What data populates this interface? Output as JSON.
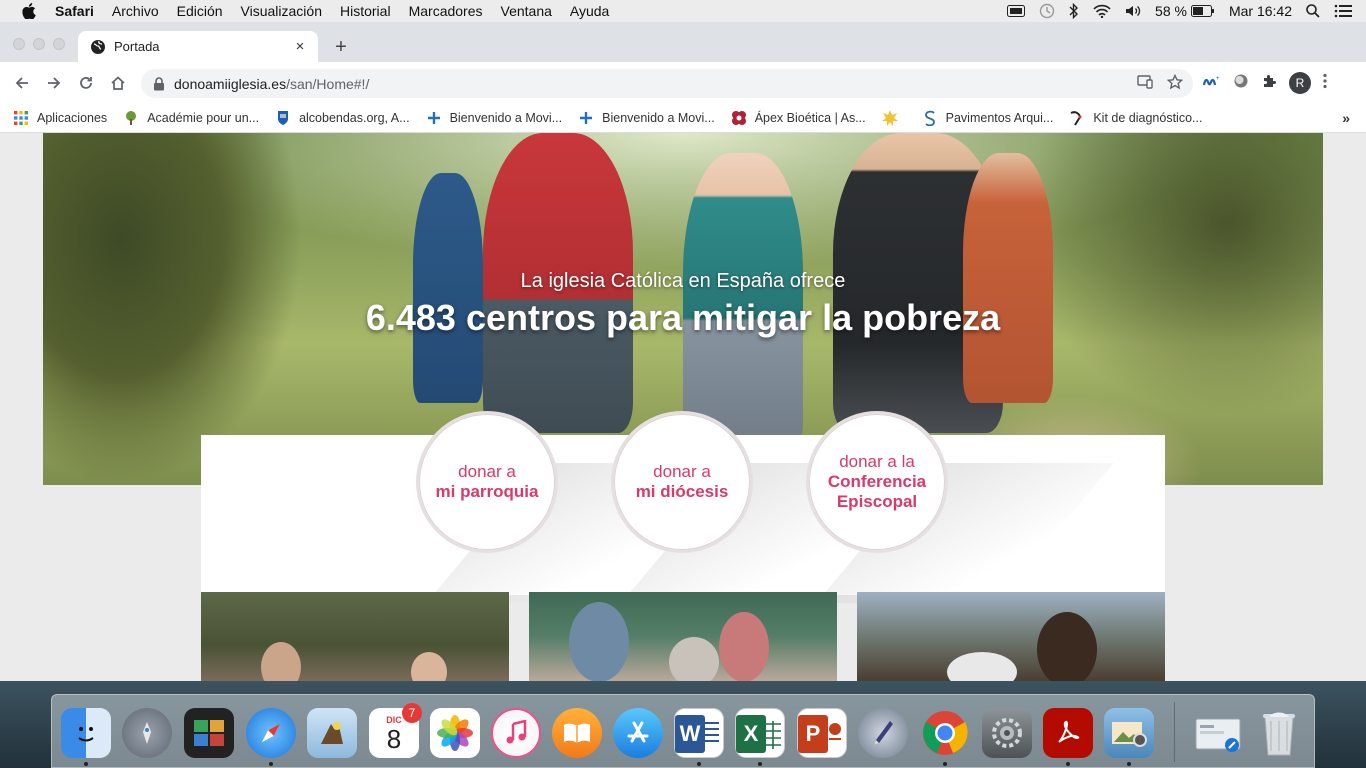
{
  "menubar": {
    "app_name": "Safari",
    "menus": [
      "Archivo",
      "Edición",
      "Visualización",
      "Historial",
      "Marcadores",
      "Ventana",
      "Ayuda"
    ],
    "battery": "58 %",
    "clock": "Mar 16:42"
  },
  "tab": {
    "title": "Portada",
    "close": "×",
    "new_tab": "+"
  },
  "address": {
    "host": "donoamiiglesia.es",
    "path": "/san/Home#!/"
  },
  "profile_initial": "R",
  "bookmarks": [
    {
      "label": "Aplicaciones",
      "icon": "apps-grid-icon"
    },
    {
      "label": "Académie pour un...",
      "icon": "tree-icon"
    },
    {
      "label": "alcobendas.org, A...",
      "icon": "shield-icon"
    },
    {
      "label": "Bienvenido a Movi...",
      "icon": "plus-icon"
    },
    {
      "label": "Bienvenido a Movi...",
      "icon": "plus-icon"
    },
    {
      "label": "Ápex Bioética | As...",
      "icon": "apex-icon"
    },
    {
      "label": "",
      "icon": "star-burst-icon"
    },
    {
      "label": "Pavimentos Arqui...",
      "icon": "s-logo-icon"
    },
    {
      "label": "Kit de diagnóstico...",
      "icon": "pen-icon"
    }
  ],
  "bookmarks_more": "»",
  "hero": {
    "subtitle": "La iglesia Católica en España ofrece",
    "title": "6.483 centros para mitigar la pobreza"
  },
  "donate": [
    {
      "line1": "donar a",
      "line2": "mi parroquia"
    },
    {
      "line1": "donar a",
      "line2": "mi diócesis"
    },
    {
      "line1": "donar a la",
      "line2": "Conferencia Episcopal"
    }
  ],
  "dock": {
    "calendar_month": "DIC",
    "calendar_day": "8",
    "calendar_badge": "7",
    "apps": [
      "finder",
      "launchpad",
      "photo-booth",
      "safari",
      "preview",
      "calendar",
      "photos",
      "itunes",
      "ibooks",
      "app-store",
      "word",
      "excel",
      "powerpoint",
      "script-editor",
      "chrome",
      "system-preferences",
      "acrobat",
      "image-capture",
      "screenshot",
      "trash"
    ]
  },
  "colors": {
    "accent_pink": "#d83a6a",
    "page_bg": "#ebebeb",
    "chrome_tabstrip": "#dee1e6"
  }
}
